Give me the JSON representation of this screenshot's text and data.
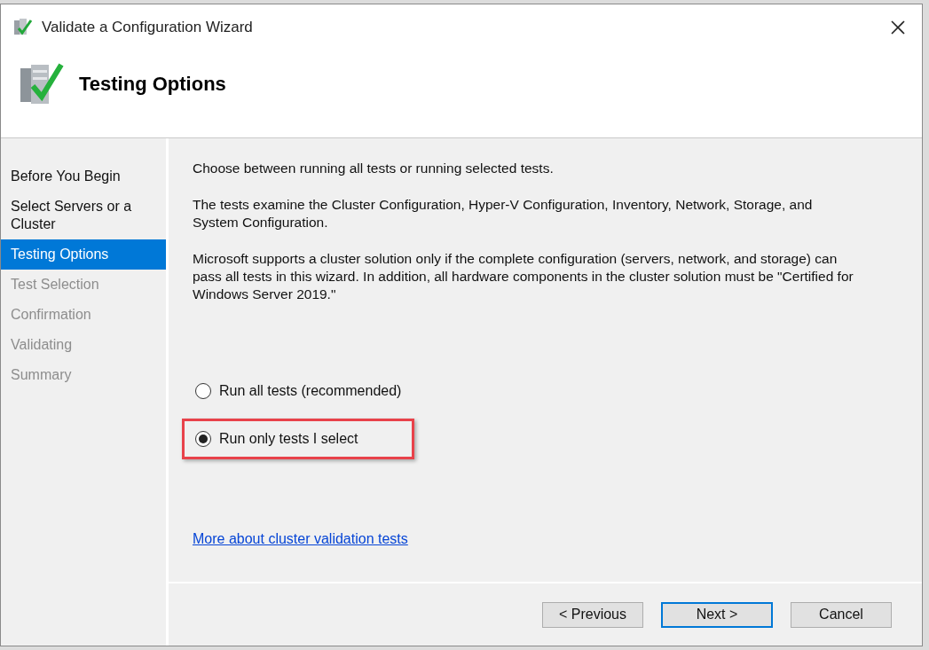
{
  "window": {
    "title": "Validate a Configuration Wizard"
  },
  "header": {
    "title": "Testing Options"
  },
  "sidebar": {
    "items": [
      {
        "label": "Before You Begin",
        "selected": false,
        "disabled": false
      },
      {
        "label": "Select Servers or a Cluster",
        "selected": false,
        "disabled": false
      },
      {
        "label": "Testing Options",
        "selected": true,
        "disabled": false
      },
      {
        "label": "Test Selection",
        "selected": false,
        "disabled": true
      },
      {
        "label": "Confirmation",
        "selected": false,
        "disabled": true
      },
      {
        "label": "Validating",
        "selected": false,
        "disabled": true
      },
      {
        "label": "Summary",
        "selected": false,
        "disabled": true
      }
    ]
  },
  "content": {
    "paragraphs": [
      "Choose between running all tests or running selected tests.",
      "The tests examine the Cluster Configuration, Hyper-V Configuration, Inventory, Network, Storage, and System Configuration.",
      "Microsoft supports a cluster solution only if the complete configuration (servers, network, and storage) can pass all tests in this wizard. In addition, all hardware components in the cluster solution must be \"Certified for Windows Server 2019.\""
    ],
    "options": [
      {
        "label": "Run all tests (recommended)",
        "selected": false,
        "highlighted": false
      },
      {
        "label": "Run only tests I select",
        "selected": true,
        "highlighted": true
      }
    ],
    "link": "More about cluster validation tests"
  },
  "buttons": [
    {
      "label": "< Previous",
      "default": false
    },
    {
      "label": "Next >",
      "default": true
    },
    {
      "label": "Cancel",
      "default": false
    }
  ]
}
